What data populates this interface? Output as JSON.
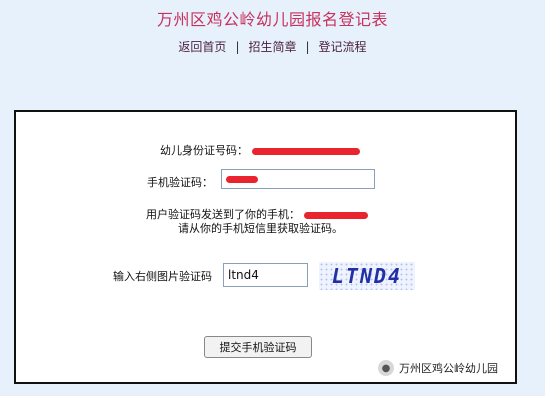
{
  "page": {
    "title": "万州区鸡公岭幼儿园报名登记表"
  },
  "nav": {
    "items": [
      "返回首页",
      "招生简章",
      "登记流程"
    ],
    "separator": "|"
  },
  "form": {
    "id_label": "幼儿身份证号码：",
    "phone_code_label": "手机验证码：",
    "sent_notice_line1": "用户验证码发送到了你的手机：",
    "sent_notice_line2": "请从你的手机短信里获取验证码。",
    "captcha_label": "输入右侧图片验证码",
    "captcha_input_value": "ltnd4",
    "captcha_image_text": "LTND4",
    "submit_label": "提交手机验证码"
  },
  "watermark": {
    "text": "万州区鸡公岭幼儿园",
    "icon": "wechat-bubble-icon"
  },
  "colors": {
    "background": "#e6f1fb",
    "title": "#c8315d",
    "redaction": "#e9242f",
    "captcha_text": "#232fa4"
  }
}
